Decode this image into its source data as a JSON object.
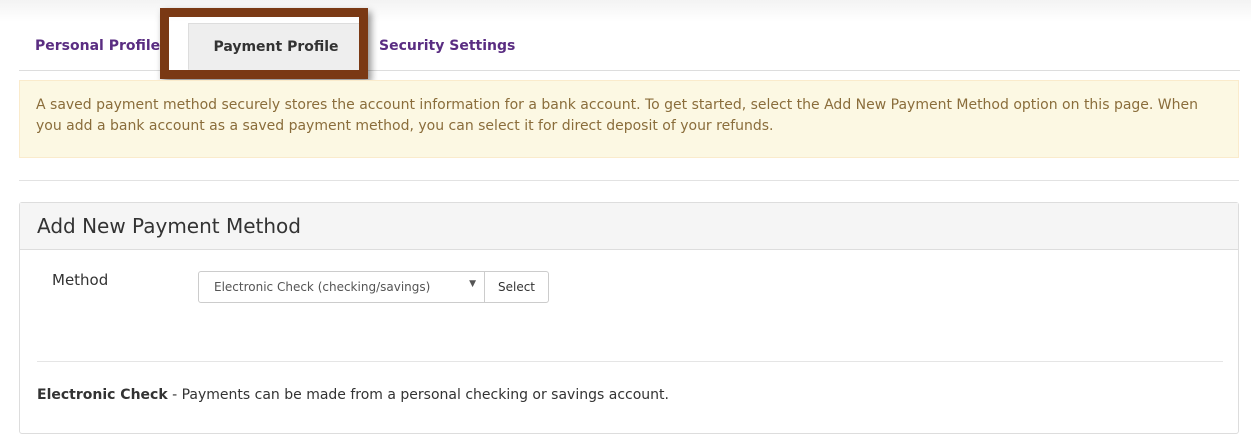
{
  "tabs": {
    "personal_profile": "Personal Profile",
    "payment_profile": "Payment Profile",
    "security_settings": "Security Settings",
    "active": "Payment Profile"
  },
  "alert": {
    "text": "A saved payment method securely stores the account information for a bank account. To get started, select the Add New Payment Method option on this page. When you add a bank account as a saved payment method, you can select it for direct deposit of your refunds."
  },
  "panel": {
    "title": "Add New Payment Method",
    "method_label": "Method",
    "method_selected": "Electronic Check (checking/savings)",
    "select_button": "Select",
    "note_bold": "Electronic Check",
    "note_text": " - Payments can be made from a personal checking or savings  account."
  },
  "colors": {
    "tab_link": "#5a2d82",
    "highlight_frame": "#7a3914",
    "alert_bg": "#fcf8e3",
    "alert_text": "#8a6d3b"
  },
  "icons": {
    "select_arrow": "caret-down-icon"
  }
}
